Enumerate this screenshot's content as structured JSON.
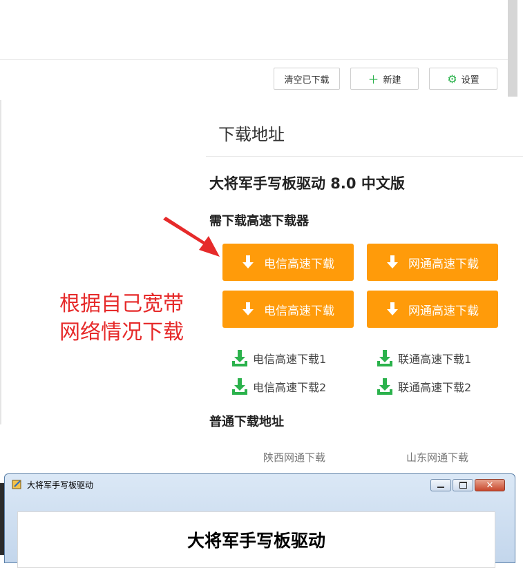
{
  "toolbar": {
    "clear_label": "清空已下载",
    "new_label": "新建",
    "settings_label": "设置"
  },
  "download_section": {
    "title": "下载地址",
    "product_title": "大将军手写板驱动 8.0 中文版",
    "need_tool_label": "需下载高速下载器",
    "fast_buttons": [
      {
        "label": "电信高速下载"
      },
      {
        "label": "网通高速下载"
      },
      {
        "label": "电信高速下载"
      },
      {
        "label": "网通高速下载"
      }
    ],
    "links": [
      {
        "label": "电信高速下载1"
      },
      {
        "label": "联通高速下载1"
      },
      {
        "label": "电信高速下载2"
      },
      {
        "label": "联通高速下载2"
      }
    ],
    "annotation_line1": "根据自己宽带",
    "annotation_line2": "网络情况下载",
    "normal_title": "普通下载地址",
    "plain_links": [
      {
        "label": "陕西网通下载"
      },
      {
        "label": "山东网通下载"
      }
    ]
  },
  "window": {
    "title": "大将军手写板驱动",
    "heading": "大将军手写板驱动"
  },
  "colors": {
    "orange_button": "#ff9b0a",
    "green_icon": "#2bb24c",
    "annotation_red": "#e62a2a"
  }
}
